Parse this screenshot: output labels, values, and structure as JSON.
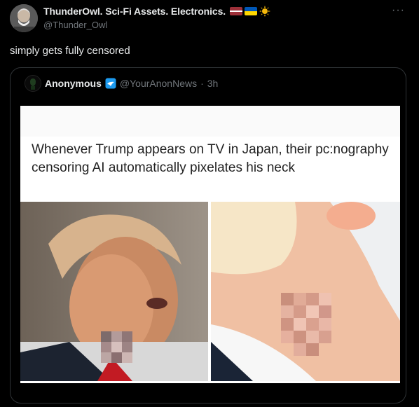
{
  "post": {
    "author_name": "ThunderOwl. Sci-Fi Assets. Electronics.",
    "author_handle": "@Thunder_Owl",
    "text": "simply gets fully censored",
    "more_label": "···",
    "badges": [
      "latvia-flag-icon",
      "ukraine-flag-icon",
      "sun-emoji-icon"
    ]
  },
  "quote": {
    "author_name": "Anonymous",
    "author_handle": "@YourAnonNews",
    "separator": "·",
    "time": "3h",
    "verified_color": "#1d9bf0",
    "media_caption": "Whenever Trump appears on TV in Japan, their pc:nography censoring AI automatically pixelates his neck"
  },
  "colors": {
    "background": "#000000",
    "text_primary": "#e7e9ea",
    "text_secondary": "#71767b",
    "border": "#2f3336"
  }
}
